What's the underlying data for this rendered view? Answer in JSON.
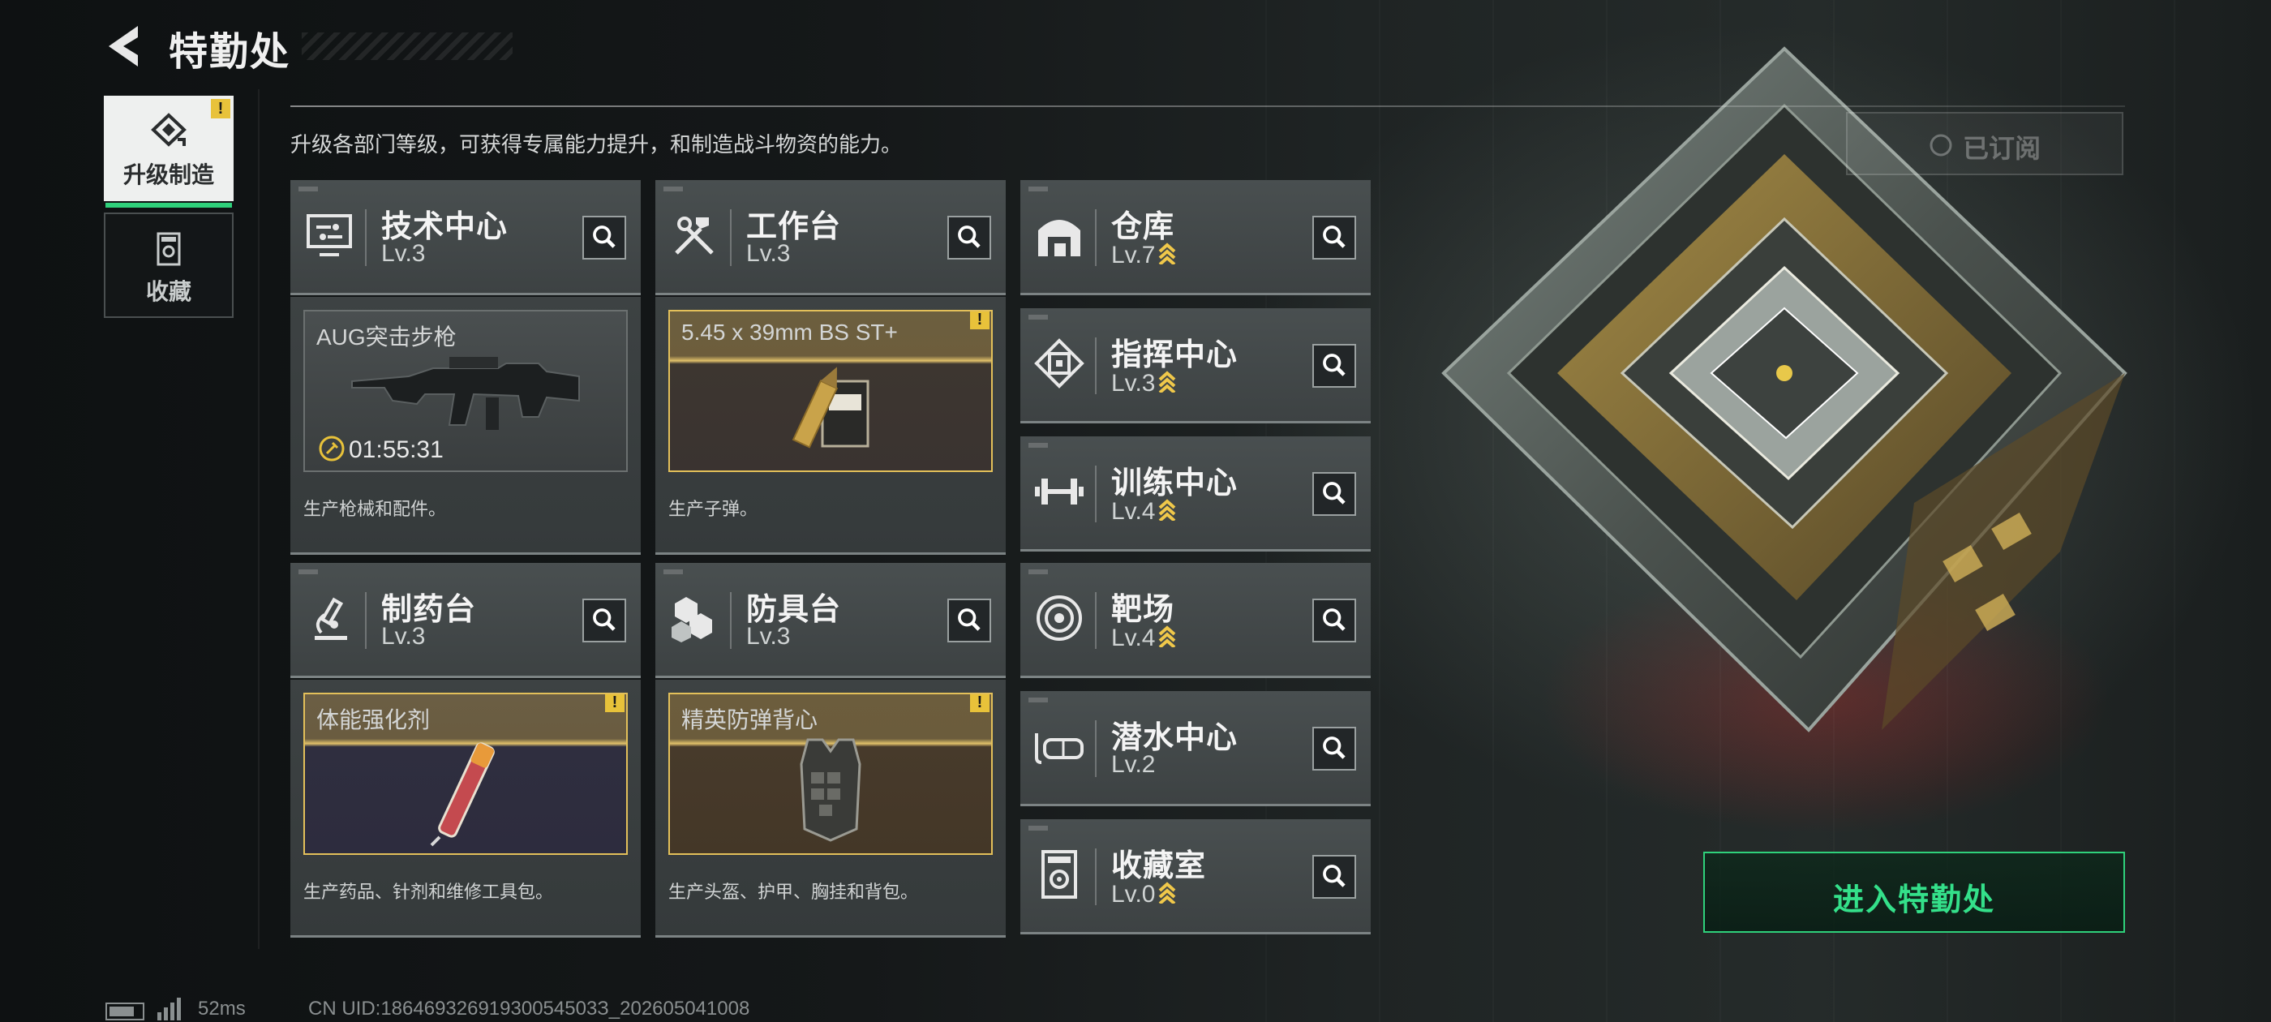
{
  "header": {
    "title": "特勤处"
  },
  "side_tabs": [
    {
      "label": "升级制造",
      "active": true,
      "has_alert": true
    },
    {
      "label": "收藏",
      "active": false,
      "has_alert": false
    }
  ],
  "description": "升级各部门等级，可获得专属能力提升，和制造战斗物资的能力。",
  "subscribed_label": "已订阅",
  "departments": [
    {
      "name": "技术中心",
      "level": "Lv.3",
      "upgradable": false,
      "icon": "tech-center-icon"
    },
    {
      "name": "工作台",
      "level": "Lv.3",
      "upgradable": false,
      "icon": "workbench-icon"
    },
    {
      "name": "仓库",
      "level": "Lv.7",
      "upgradable": true,
      "icon": "warehouse-icon"
    },
    {
      "name": "指挥中心",
      "level": "Lv.3",
      "upgradable": true,
      "icon": "command-center-icon"
    },
    {
      "name": "训练中心",
      "level": "Lv.4",
      "upgradable": true,
      "icon": "training-center-icon"
    },
    {
      "name": "制药台",
      "level": "Lv.3",
      "upgradable": false,
      "icon": "pharmacy-icon"
    },
    {
      "name": "防具台",
      "level": "Lv.3",
      "upgradable": false,
      "icon": "armor-bench-icon"
    },
    {
      "name": "靶场",
      "level": "Lv.4",
      "upgradable": true,
      "icon": "shooting-range-icon"
    },
    {
      "name": "潜水中心",
      "level": "Lv.2",
      "upgradable": false,
      "icon": "diving-center-icon"
    },
    {
      "name": "收藏室",
      "level": "Lv.0",
      "upgradable": true,
      "icon": "collection-room-icon"
    }
  ],
  "production": [
    {
      "item": "AUG突击步枪",
      "timer": "01:55:31",
      "desc": "生产枪械和配件。",
      "alert": false
    },
    {
      "item": "5.45 x 39mm BS ST+",
      "timer": "",
      "desc": "生产子弹。",
      "alert": true
    },
    {
      "item": "体能强化剂",
      "timer": "",
      "desc": "生产药品、针剂和维修工具包。",
      "alert": true
    },
    {
      "item": "精英防弹背心",
      "timer": "",
      "desc": "生产头盔、护甲、胸挂和背包。",
      "alert": true
    }
  ],
  "alert_mark": "!",
  "enter_button": "进入特勤处",
  "footer": {
    "ping": "52ms",
    "uid": "CN UID:18646932691930054503З_202605041008"
  },
  "colors": {
    "accent_green": "#2fd17b",
    "gold": "#e3c05a",
    "upgrade_chevron": "#f0c84a"
  }
}
